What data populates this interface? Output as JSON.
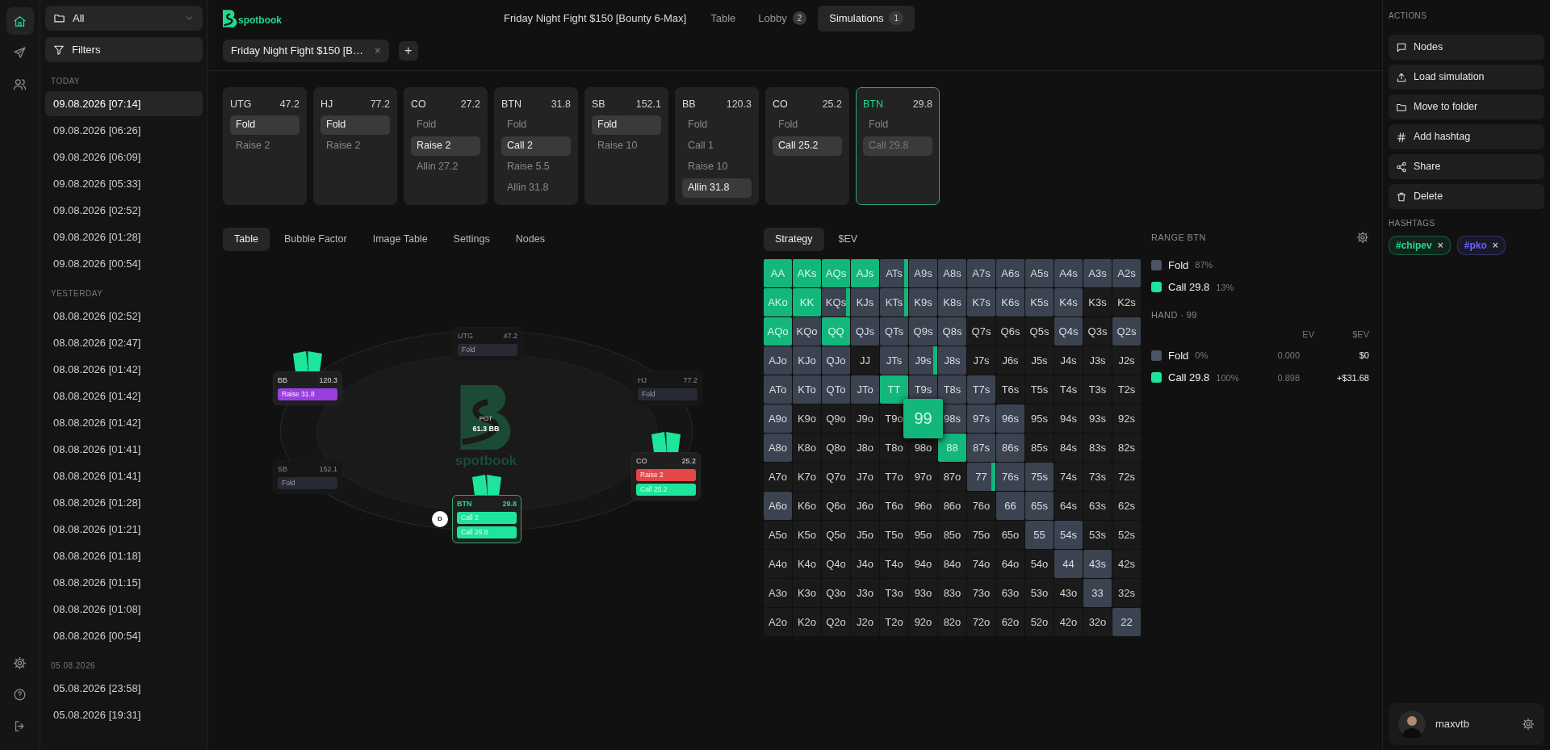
{
  "rail": {
    "top": [
      {
        "selected": true
      },
      {
        "selected": false
      },
      {
        "selected": false
      }
    ]
  },
  "sidebar": {
    "folder_select": {
      "value": "All"
    },
    "filters_button": "Filters",
    "groups": [
      {
        "title": "TODAY",
        "items": [
          {
            "label": "09.08.2026 [07:14]",
            "selected": true
          },
          {
            "label": "09.08.2026 [06:26]",
            "selected": false
          },
          {
            "label": "09.08.2026 [06:09]",
            "selected": false
          },
          {
            "label": "09.08.2026 [05:33]",
            "selected": false
          },
          {
            "label": "09.08.2026 [02:52]",
            "selected": false
          },
          {
            "label": "09.08.2026 [01:28]",
            "selected": false
          },
          {
            "label": "09.08.2026 [00:54]",
            "selected": false
          }
        ]
      },
      {
        "title": "YESTERDAY",
        "items": [
          {
            "label": "08.08.2026 [02:52]",
            "selected": false
          },
          {
            "label": "08.08.2026 [02:47]",
            "selected": false
          },
          {
            "label": "08.08.2026 [01:42]",
            "selected": false
          },
          {
            "label": "08.08.2026 [01:42]",
            "selected": false
          },
          {
            "label": "08.08.2026 [01:42]",
            "selected": false
          },
          {
            "label": "08.08.2026 [01:41]",
            "selected": false
          },
          {
            "label": "08.08.2026 [01:41]",
            "selected": false
          },
          {
            "label": "08.08.2026 [01:28]",
            "selected": false
          },
          {
            "label": "08.08.2026 [01:21]",
            "selected": false
          },
          {
            "label": "08.08.2026 [01:18]",
            "selected": false
          },
          {
            "label": "08.08.2026 [01:15]",
            "selected": false
          },
          {
            "label": "08.08.2026 [01:08]",
            "selected": false
          },
          {
            "label": "08.08.2026 [00:54]",
            "selected": false
          }
        ]
      },
      {
        "title": "05.08.2026",
        "items": [
          {
            "label": "05.08.2026 [23:58]",
            "selected": false
          },
          {
            "label": "05.08.2026 [19:31]",
            "selected": false
          }
        ]
      }
    ]
  },
  "header": {
    "logo_text": "spotbook",
    "title": "Friday Night Fight $150 [Bounty 6-Max]",
    "nav": [
      {
        "label": "Table",
        "selected": false
      },
      {
        "label": "Lobby",
        "count": "2",
        "selected": false
      },
      {
        "label": "Simulations",
        "count": "1",
        "selected": true
      }
    ],
    "doc_tabs": [
      {
        "label": "Friday Night Fight $150 [B…",
        "close": "×"
      }
    ],
    "add_tab": "+"
  },
  "action_cards": [
    {
      "position": "UTG",
      "stack": "47.2",
      "active": false,
      "options": [
        {
          "label": "Fold",
          "selected": true
        },
        {
          "label": "Raise 2",
          "selected": false
        }
      ]
    },
    {
      "position": "HJ",
      "stack": "77.2",
      "active": false,
      "options": [
        {
          "label": "Fold",
          "selected": true
        },
        {
          "label": "Raise 2",
          "selected": false
        }
      ]
    },
    {
      "position": "CO",
      "stack": "27.2",
      "active": false,
      "options": [
        {
          "label": "Fold",
          "selected": false
        },
        {
          "label": "Raise 2",
          "selected": true
        },
        {
          "label": "Allin 27.2",
          "selected": false
        }
      ]
    },
    {
      "position": "BTN",
      "stack": "31.8",
      "active": false,
      "options": [
        {
          "label": "Fold",
          "selected": false
        },
        {
          "label": "Call 2",
          "selected": true
        },
        {
          "label": "Raise 5.5",
          "selected": false
        },
        {
          "label": "Allin 31.8",
          "selected": false
        }
      ]
    },
    {
      "position": "SB",
      "stack": "152.1",
      "active": false,
      "options": [
        {
          "label": "Fold",
          "selected": true
        },
        {
          "label": "Raise 10",
          "selected": false
        }
      ]
    },
    {
      "position": "BB",
      "stack": "120.3",
      "active": false,
      "options": [
        {
          "label": "Fold",
          "selected": false
        },
        {
          "label": "Call 1",
          "selected": false
        },
        {
          "label": "Raise 10",
          "selected": false
        },
        {
          "label": "Allin 31.8",
          "selected": true
        }
      ]
    },
    {
      "position": "CO",
      "stack": "25.2",
      "active": false,
      "options": [
        {
          "label": "Fold",
          "selected": false
        },
        {
          "label": "Call 25.2",
          "selected": true
        }
      ]
    },
    {
      "position": "BTN",
      "stack": "29.8",
      "active": true,
      "options": [
        {
          "label": "Fold",
          "selected": false
        },
        {
          "label": "Call 29.8",
          "selected": true
        }
      ]
    }
  ],
  "view_tabs": [
    {
      "label": "Table",
      "selected": true
    },
    {
      "label": "Bubble Factor",
      "selected": false
    },
    {
      "label": "Image Table",
      "selected": false
    },
    {
      "label": "Settings",
      "selected": false
    },
    {
      "label": "Nodes",
      "selected": false
    }
  ],
  "range_tabs": [
    {
      "label": "Strategy",
      "selected": true
    },
    {
      "label": "$EV",
      "selected": false
    }
  ],
  "table": {
    "pot_label": "POT",
    "pot": "61.3 BB",
    "logo_text": "spotbook",
    "dealer_label": "D",
    "seats": [
      {
        "position": "UTG",
        "stack": "47.2",
        "folded": true,
        "hero": false,
        "dealer": false,
        "actions": [
          {
            "label": "Fold",
            "color": "#272a35"
          }
        ]
      },
      {
        "position": "BB",
        "stack": "120.3",
        "folded": false,
        "hero": false,
        "dealer": false,
        "actions": [
          {
            "label": "Raise 31.8",
            "color": "#9a3ee0"
          }
        ]
      },
      {
        "position": "HJ",
        "stack": "77.2",
        "folded": true,
        "hero": false,
        "dealer": false,
        "actions": [
          {
            "label": "Fold",
            "color": "#272a35"
          }
        ]
      },
      {
        "position": "SB",
        "stack": "152.1",
        "folded": true,
        "hero": false,
        "dealer": false,
        "actions": [
          {
            "label": "Fold",
            "color": "#272a35"
          }
        ]
      },
      {
        "position": "CO",
        "stack": "25.2",
        "folded": false,
        "hero": false,
        "dealer": false,
        "actions": [
          {
            "label": "Raise 2",
            "color": "#e54646"
          },
          {
            "label": "Call 25.2",
            "color": "#1de59b"
          }
        ]
      },
      {
        "position": "BTN",
        "stack": "29.8",
        "folded": false,
        "hero": true,
        "dealer": true,
        "actions": [
          {
            "label": "Call 2",
            "color": "#1de59b"
          },
          {
            "label": "Call 29.8",
            "color": "#1de59b"
          }
        ]
      }
    ]
  },
  "range_grid": {
    "rows": [
      [
        {
          "label": "AA",
          "kind": "call"
        },
        {
          "label": "AKs",
          "kind": "call"
        },
        {
          "label": "AQs",
          "kind": "call"
        },
        {
          "label": "AJs",
          "kind": "call"
        },
        {
          "label": "ATs",
          "kind": "mixed",
          "level": 0.15
        },
        {
          "label": "A9s",
          "kind": "fold"
        },
        {
          "label": "A8s",
          "kind": "fold"
        },
        {
          "label": "A7s",
          "kind": "fold"
        },
        {
          "label": "A6s",
          "kind": "fold"
        },
        {
          "label": "A5s",
          "kind": "fold"
        },
        {
          "label": "A4s",
          "kind": "fold"
        },
        {
          "label": "A3s",
          "kind": "fold"
        },
        {
          "label": "A2s",
          "kind": "fold"
        }
      ],
      [
        {
          "label": "AKo",
          "kind": "call"
        },
        {
          "label": "KK",
          "kind": "call"
        },
        {
          "label": "KQs",
          "kind": "mixed",
          "level": 0.15
        },
        {
          "label": "KJs",
          "kind": "fold"
        },
        {
          "label": "KTs",
          "kind": "mixed",
          "level": 0.15
        },
        {
          "label": "K9s",
          "kind": "fold"
        },
        {
          "label": "K8s",
          "kind": "fold"
        },
        {
          "label": "K7s",
          "kind": "fold"
        },
        {
          "label": "K6s",
          "kind": "fold"
        },
        {
          "label": "K5s",
          "kind": "fold"
        },
        {
          "label": "K4s",
          "kind": "fold"
        },
        {
          "label": "K3s",
          "kind": "none"
        },
        {
          "label": "K2s",
          "kind": "none"
        }
      ],
      [
        {
          "label": "AQo",
          "kind": "call"
        },
        {
          "label": "KQo",
          "kind": "fold"
        },
        {
          "label": "QQ",
          "kind": "call"
        },
        {
          "label": "QJs",
          "kind": "fold"
        },
        {
          "label": "QTs",
          "kind": "fold"
        },
        {
          "label": "Q9s",
          "kind": "fold"
        },
        {
          "label": "Q8s",
          "kind": "fold"
        },
        {
          "label": "Q7s",
          "kind": "none"
        },
        {
          "label": "Q6s",
          "kind": "none"
        },
        {
          "label": "Q5s",
          "kind": "none"
        },
        {
          "label": "Q4s",
          "kind": "fold"
        },
        {
          "label": "Q3s",
          "kind": "none"
        },
        {
          "label": "Q2s",
          "kind": "fold"
        }
      ],
      [
        {
          "label": "AJo",
          "kind": "fold"
        },
        {
          "label": "KJo",
          "kind": "fold"
        },
        {
          "label": "QJo",
          "kind": "fold"
        },
        {
          "label": "JJ",
          "kind": "none"
        },
        {
          "label": "JTs",
          "kind": "fold"
        },
        {
          "label": "J9s",
          "kind": "mixed",
          "level": 0.15
        },
        {
          "label": "J8s",
          "kind": "fold"
        },
        {
          "label": "J7s",
          "kind": "none"
        },
        {
          "label": "J6s",
          "kind": "none"
        },
        {
          "label": "J5s",
          "kind": "none"
        },
        {
          "label": "J4s",
          "kind": "none"
        },
        {
          "label": "J3s",
          "kind": "none"
        },
        {
          "label": "J2s",
          "kind": "none"
        }
      ],
      [
        {
          "label": "ATo",
          "kind": "fold"
        },
        {
          "label": "KTo",
          "kind": "fold"
        },
        {
          "label": "QTo",
          "kind": "fold"
        },
        {
          "label": "JTo",
          "kind": "fold"
        },
        {
          "label": "TT",
          "kind": "call"
        },
        {
          "label": "T9s",
          "kind": "fold"
        },
        {
          "label": "T8s",
          "kind": "fold"
        },
        {
          "label": "T7s",
          "kind": "fold"
        },
        {
          "label": "T6s",
          "kind": "none"
        },
        {
          "label": "T5s",
          "kind": "none"
        },
        {
          "label": "T4s",
          "kind": "none"
        },
        {
          "label": "T3s",
          "kind": "none"
        },
        {
          "label": "T2s",
          "kind": "none"
        }
      ],
      [
        {
          "label": "A9o",
          "kind": "fold"
        },
        {
          "label": "K9o",
          "kind": "none"
        },
        {
          "label": "Q9o",
          "kind": "none"
        },
        {
          "label": "J9o",
          "kind": "none"
        },
        {
          "label": "T9o",
          "kind": "none"
        },
        {
          "label": "99",
          "kind": "hovered"
        },
        {
          "label": "98s",
          "kind": "fold"
        },
        {
          "label": "97s",
          "kind": "fold"
        },
        {
          "label": "96s",
          "kind": "fold"
        },
        {
          "label": "95s",
          "kind": "none"
        },
        {
          "label": "94s",
          "kind": "none"
        },
        {
          "label": "93s",
          "kind": "none"
        },
        {
          "label": "92s",
          "kind": "none"
        }
      ],
      [
        {
          "label": "A8o",
          "kind": "fold"
        },
        {
          "label": "K8o",
          "kind": "none"
        },
        {
          "label": "Q8o",
          "kind": "none"
        },
        {
          "label": "J8o",
          "kind": "none"
        },
        {
          "label": "T8o",
          "kind": "none"
        },
        {
          "label": "98o",
          "kind": "none"
        },
        {
          "label": "88",
          "kind": "call"
        },
        {
          "label": "87s",
          "kind": "fold"
        },
        {
          "label": "86s",
          "kind": "fold"
        },
        {
          "label": "85s",
          "kind": "none"
        },
        {
          "label": "84s",
          "kind": "none"
        },
        {
          "label": "83s",
          "kind": "none"
        },
        {
          "label": "82s",
          "kind": "none"
        }
      ],
      [
        {
          "label": "A7o",
          "kind": "none"
        },
        {
          "label": "K7o",
          "kind": "none"
        },
        {
          "label": "Q7o",
          "kind": "none"
        },
        {
          "label": "J7o",
          "kind": "none"
        },
        {
          "label": "T7o",
          "kind": "none"
        },
        {
          "label": "97o",
          "kind": "none"
        },
        {
          "label": "87o",
          "kind": "none"
        },
        {
          "label": "77",
          "kind": "mixed",
          "level": 0.15
        },
        {
          "label": "76s",
          "kind": "fold"
        },
        {
          "label": "75s",
          "kind": "fold"
        },
        {
          "label": "74s",
          "kind": "none"
        },
        {
          "label": "73s",
          "kind": "none"
        },
        {
          "label": "72s",
          "kind": "none"
        }
      ],
      [
        {
          "label": "A6o",
          "kind": "fold"
        },
        {
          "label": "K6o",
          "kind": "none"
        },
        {
          "label": "Q6o",
          "kind": "none"
        },
        {
          "label": "J6o",
          "kind": "none"
        },
        {
          "label": "T6o",
          "kind": "none"
        },
        {
          "label": "96o",
          "kind": "none"
        },
        {
          "label": "86o",
          "kind": "none"
        },
        {
          "label": "76o",
          "kind": "none"
        },
        {
          "label": "66",
          "kind": "fold"
        },
        {
          "label": "65s",
          "kind": "fold"
        },
        {
          "label": "64s",
          "kind": "none"
        },
        {
          "label": "63s",
          "kind": "none"
        },
        {
          "label": "62s",
          "kind": "none"
        }
      ],
      [
        {
          "label": "A5o",
          "kind": "none"
        },
        {
          "label": "K5o",
          "kind": "none"
        },
        {
          "label": "Q5o",
          "kind": "none"
        },
        {
          "label": "J5o",
          "kind": "none"
        },
        {
          "label": "T5o",
          "kind": "none"
        },
        {
          "label": "95o",
          "kind": "none"
        },
        {
          "label": "85o",
          "kind": "none"
        },
        {
          "label": "75o",
          "kind": "none"
        },
        {
          "label": "65o",
          "kind": "none"
        },
        {
          "label": "55",
          "kind": "fold"
        },
        {
          "label": "54s",
          "kind": "fold"
        },
        {
          "label": "53s",
          "kind": "none"
        },
        {
          "label": "52s",
          "kind": "none"
        }
      ],
      [
        {
          "label": "A4o",
          "kind": "none"
        },
        {
          "label": "K4o",
          "kind": "none"
        },
        {
          "label": "Q4o",
          "kind": "none"
        },
        {
          "label": "J4o",
          "kind": "none"
        },
        {
          "label": "T4o",
          "kind": "none"
        },
        {
          "label": "94o",
          "kind": "none"
        },
        {
          "label": "84o",
          "kind": "none"
        },
        {
          "label": "74o",
          "kind": "none"
        },
        {
          "label": "64o",
          "kind": "none"
        },
        {
          "label": "54o",
          "kind": "none"
        },
        {
          "label": "44",
          "kind": "fold"
        },
        {
          "label": "43s",
          "kind": "fold"
        },
        {
          "label": "42s",
          "kind": "none"
        }
      ],
      [
        {
          "label": "A3o",
          "kind": "none"
        },
        {
          "label": "K3o",
          "kind": "none"
        },
        {
          "label": "Q3o",
          "kind": "none"
        },
        {
          "label": "J3o",
          "kind": "none"
        },
        {
          "label": "T3o",
          "kind": "none"
        },
        {
          "label": "93o",
          "kind": "none"
        },
        {
          "label": "83o",
          "kind": "none"
        },
        {
          "label": "73o",
          "kind": "none"
        },
        {
          "label": "63o",
          "kind": "none"
        },
        {
          "label": "53o",
          "kind": "none"
        },
        {
          "label": "43o",
          "kind": "none"
        },
        {
          "label": "33",
          "kind": "fold"
        },
        {
          "label": "32s",
          "kind": "none"
        }
      ],
      [
        {
          "label": "A2o",
          "kind": "none"
        },
        {
          "label": "K2o",
          "kind": "none"
        },
        {
          "label": "Q2o",
          "kind": "none"
        },
        {
          "label": "J2o",
          "kind": "none"
        },
        {
          "label": "T2o",
          "kind": "none"
        },
        {
          "label": "92o",
          "kind": "none"
        },
        {
          "label": "82o",
          "kind": "none"
        },
        {
          "label": "72o",
          "kind": "none"
        },
        {
          "label": "62o",
          "kind": "none"
        },
        {
          "label": "52o",
          "kind": "none"
        },
        {
          "label": "42o",
          "kind": "none"
        },
        {
          "label": "32o",
          "kind": "none"
        },
        {
          "label": "22",
          "kind": "fold"
        }
      ]
    ]
  },
  "range_panel": {
    "title": "RANGE BTN",
    "legend": [
      {
        "label": "Fold",
        "pct": "87%",
        "color": "#4b5364"
      },
      {
        "label": "Call 29.8",
        "pct": "13%",
        "color": "#1de59b"
      }
    ],
    "hand_title": "HAND · 99",
    "columns": [
      "EV",
      "$EV"
    ],
    "hand_rows": [
      {
        "label": "Fold",
        "pct": "0%",
        "color": "#4b5364",
        "ev": "0.000",
        "sev": "$0"
      },
      {
        "label": "Call 29.8",
        "pct": "100%",
        "color": "#1de59b",
        "ev": "0.898",
        "sev": "+$31.68"
      }
    ]
  },
  "actions_panel": {
    "title": "ACTIONS",
    "buttons": [
      "Nodes",
      "Load simulation",
      "Move to folder",
      "Add hashtag",
      "Share",
      "Delete"
    ],
    "hashtags_title": "HASHTAGS",
    "hashtags": [
      {
        "label": "#chipev",
        "color": "#22d98e",
        "remove": "×"
      },
      {
        "label": "#pko",
        "color": "#6b63ff",
        "remove": "×"
      }
    ]
  },
  "user": {
    "name": "maxvtb"
  }
}
